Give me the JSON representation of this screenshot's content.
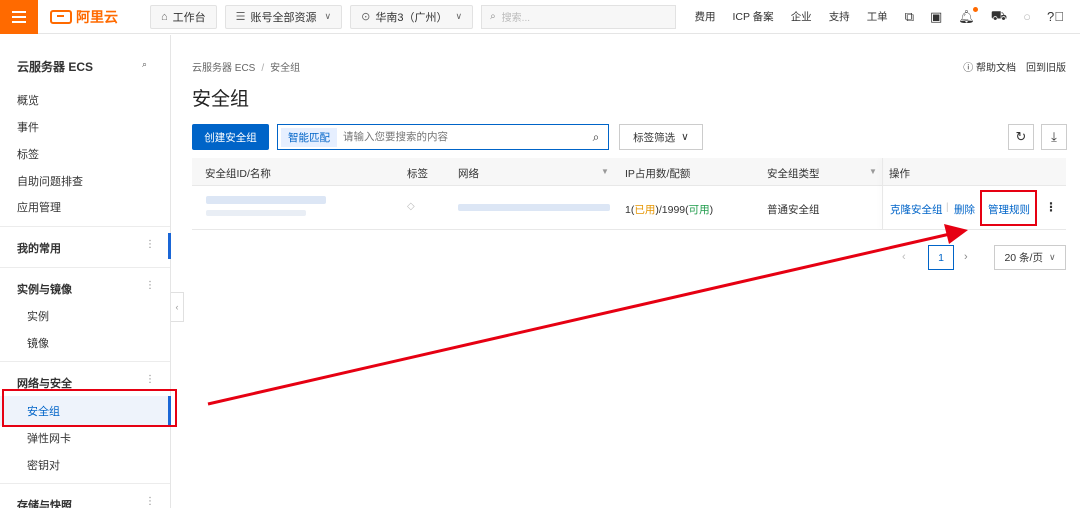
{
  "topbar": {
    "logo": "阿里云",
    "workbench": "工作台",
    "resources": "账号全部资源",
    "region": "华南3（广州）",
    "search_placeholder": "搜索...",
    "links": [
      "费用",
      "ICP 备案",
      "企业",
      "支持",
      "工单"
    ]
  },
  "sidebar": {
    "title": "云服务器 ECS",
    "top_items": [
      "概览",
      "事件",
      "标签",
      "自助问题排查",
      "应用管理"
    ],
    "mine": "我的常用",
    "group_instances": "实例与镜像",
    "instances_items": [
      "实例",
      "镜像"
    ],
    "group_network": "网络与安全",
    "network_items": [
      "安全组",
      "弹性网卡",
      "密钥对"
    ],
    "group_storage": "存储与快照"
  },
  "main": {
    "breadcrumb": [
      "云服务器 ECS",
      "安全组"
    ],
    "title": "安全组",
    "help": "帮助文档",
    "back_old": "回到旧版",
    "create_button": "创建安全组",
    "smart_match": "智能匹配",
    "search_placeholder": "请输入您要搜索的内容",
    "tag_filter": "标签筛选"
  },
  "table": {
    "columns": [
      "安全组ID/名称",
      "标签",
      "网络",
      "IP占用数/配额",
      "安全组类型",
      "操作"
    ],
    "row": {
      "ip_used": "1",
      "ip_used_label": "已用",
      "ip_quota": "1999",
      "ip_quota_label": "可用",
      "type": "普通安全组",
      "ops": [
        "克隆安全组",
        "删除",
        "管理规则"
      ]
    }
  },
  "pagination": {
    "current": "1",
    "page_size": "20 条/页"
  },
  "colors": {
    "brand": "#ff6a00",
    "primary": "#0064c8",
    "annotation": "#e60012"
  }
}
